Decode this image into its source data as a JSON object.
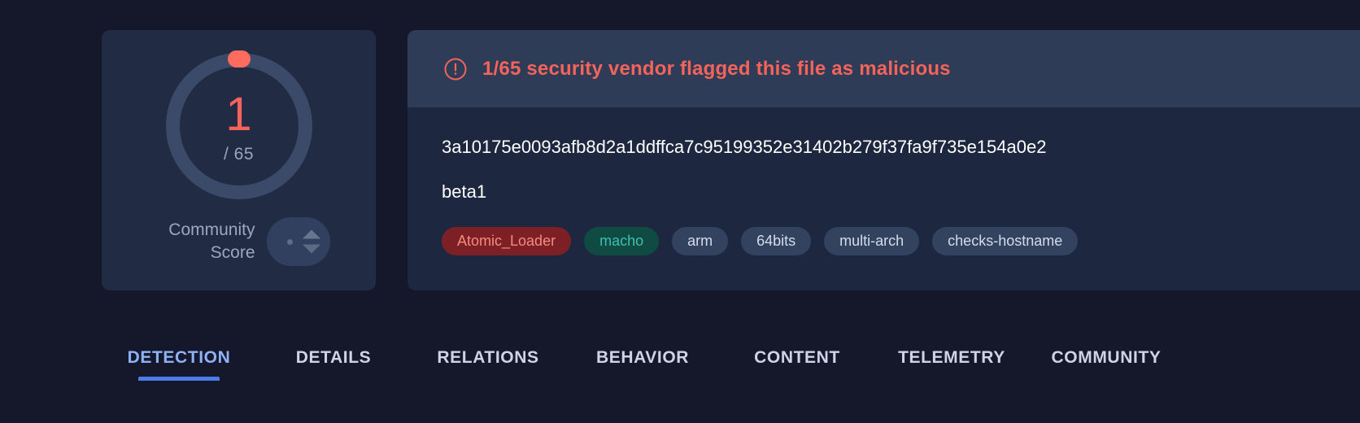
{
  "colors": {
    "page_background": "#15172a",
    "card_background": "#222b44",
    "panel_background": "#1e2740",
    "banner_background": "#2f3c57",
    "malicious_red": "#f4645a",
    "ring_track": "#3b4a69",
    "active_tab_blue": "#8fb2f7",
    "tab_underline_blue": "#4b7ce8",
    "threat_tag_background": "#7d2026",
    "threat_tag_text": "#f58a80",
    "type_tag_background": "#0f4a43",
    "type_tag_text": "#3fbfae",
    "neutral_tag_background": "#32425f"
  },
  "score_card": {
    "detections": "1",
    "total_label": "/ 65",
    "community_score_label": "Community Score",
    "vote_up_icon": "arrow-up-icon",
    "vote_down_icon": "arrow-down-icon",
    "marker_icon": "gauge-marker"
  },
  "detection_banner": {
    "icon": "alert-circle-icon",
    "message": "1/65 security vendor flagged this file as malicious"
  },
  "file_info": {
    "file_name_line1": "3a10175e0093afb8d2a1ddffca7c95199352e31402b279f37fa9f735e154a0e2",
    "file_name_line2": "beta1",
    "tags": [
      {
        "label": "Atomic_Loader",
        "kind": "threat"
      },
      {
        "label": "macho",
        "kind": "type"
      },
      {
        "label": "arm",
        "kind": "neutral"
      },
      {
        "label": "64bits",
        "kind": "neutral"
      },
      {
        "label": "multi-arch",
        "kind": "neutral"
      },
      {
        "label": "checks-hostname",
        "kind": "neutral"
      }
    ]
  },
  "tabs": {
    "active_index": 0,
    "items": [
      {
        "label": "DETECTION"
      },
      {
        "label": "DETAILS"
      },
      {
        "label": "RELATIONS"
      },
      {
        "label": "BEHAVIOR"
      },
      {
        "label": "CONTENT"
      },
      {
        "label": "TELEMETRY"
      },
      {
        "label": "COMMUNITY"
      }
    ]
  }
}
